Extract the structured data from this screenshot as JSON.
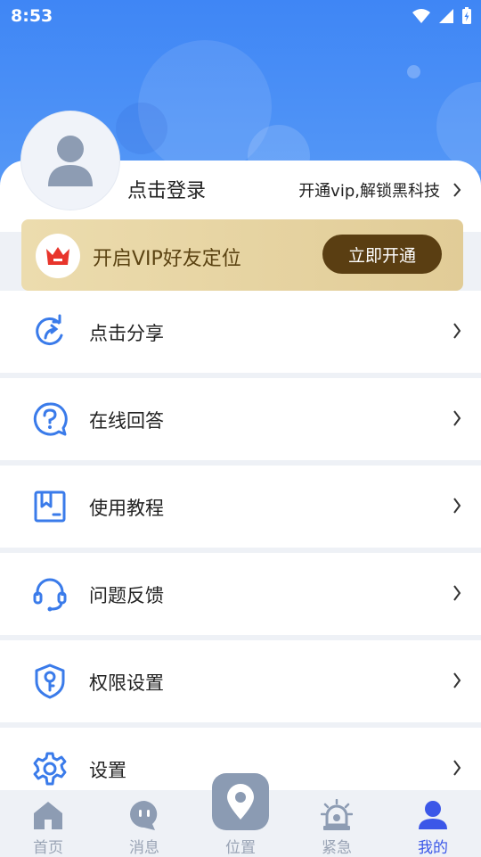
{
  "status_bar": {
    "time": "8:53"
  },
  "profile": {
    "login_text": "点击登录",
    "vip_link": "开通vip,解锁黑科技"
  },
  "vip_banner": {
    "title": "开启VIP好友定位",
    "button": "立即开通"
  },
  "menu": {
    "items": [
      {
        "label": "点击分享",
        "icon": "share-icon"
      },
      {
        "label": "在线回答",
        "icon": "question-icon"
      },
      {
        "label": "使用教程",
        "icon": "bookmark-icon"
      },
      {
        "label": "问题反馈",
        "icon": "headset-icon"
      },
      {
        "label": "权限设置",
        "icon": "shield-key-icon"
      },
      {
        "label": "设置",
        "icon": "gear-icon"
      }
    ]
  },
  "tabbar": {
    "tabs": [
      {
        "label": "首页",
        "icon": "home-icon"
      },
      {
        "label": "消息",
        "icon": "message-icon"
      },
      {
        "label": "位置",
        "icon": "location-pin-icon"
      },
      {
        "label": "紧急",
        "icon": "alarm-icon"
      },
      {
        "label": "我的",
        "icon": "user-icon"
      }
    ],
    "active": "我的"
  },
  "colors": {
    "header_blue": "#3f86f5",
    "icon_blue": "#3a7bea",
    "vip_gold": "#e1cc97",
    "vip_button": "#5a3e12",
    "tab_active": "#3b57e8",
    "tab_inactive": "#9aa4b5"
  }
}
